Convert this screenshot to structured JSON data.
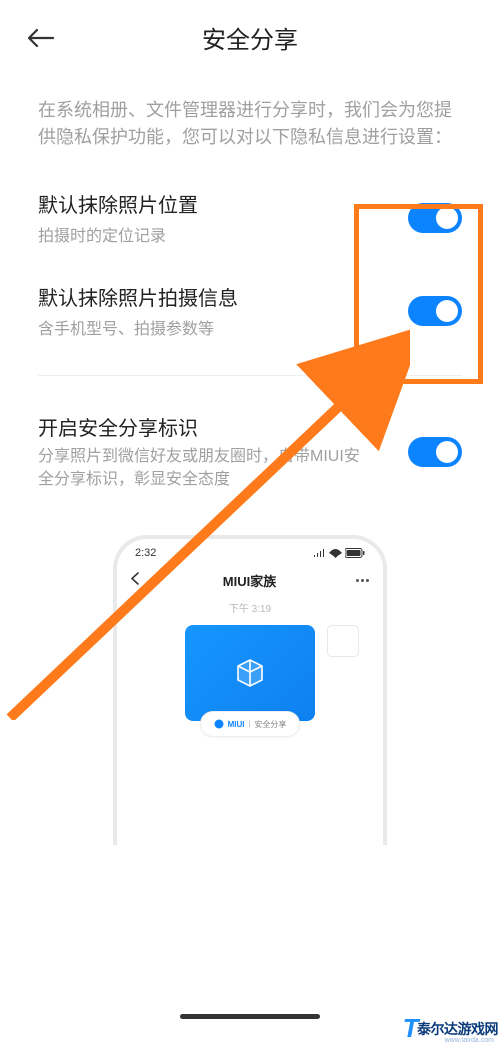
{
  "header": {
    "title": "安全分享"
  },
  "description": "在系统相册、文件管理器进行分享时，我们会为您提供隐私保护功能，您可以对以下隐私信息进行设置：",
  "settings": {
    "item1": {
      "title": "默认抹除照片位置",
      "sub": "拍摄时的定位记录"
    },
    "item2": {
      "title": "默认抹除照片拍摄信息",
      "sub": "含手机型号、拍摄参数等"
    },
    "item3": {
      "title": "开启安全分享标识",
      "sub": "分享照片到微信好友或朋友圈时，自带MIUI安全分享标识，彰显安全态度"
    }
  },
  "preview": {
    "status_time": "2:32",
    "chat_title": "MIUI家族",
    "chat_time": "下午 3:19",
    "badge_brand": "MIUI",
    "badge_text": "安全分享"
  },
  "watermark": {
    "brand": "泰尔达游戏网",
    "url": "www.tairda.com"
  }
}
